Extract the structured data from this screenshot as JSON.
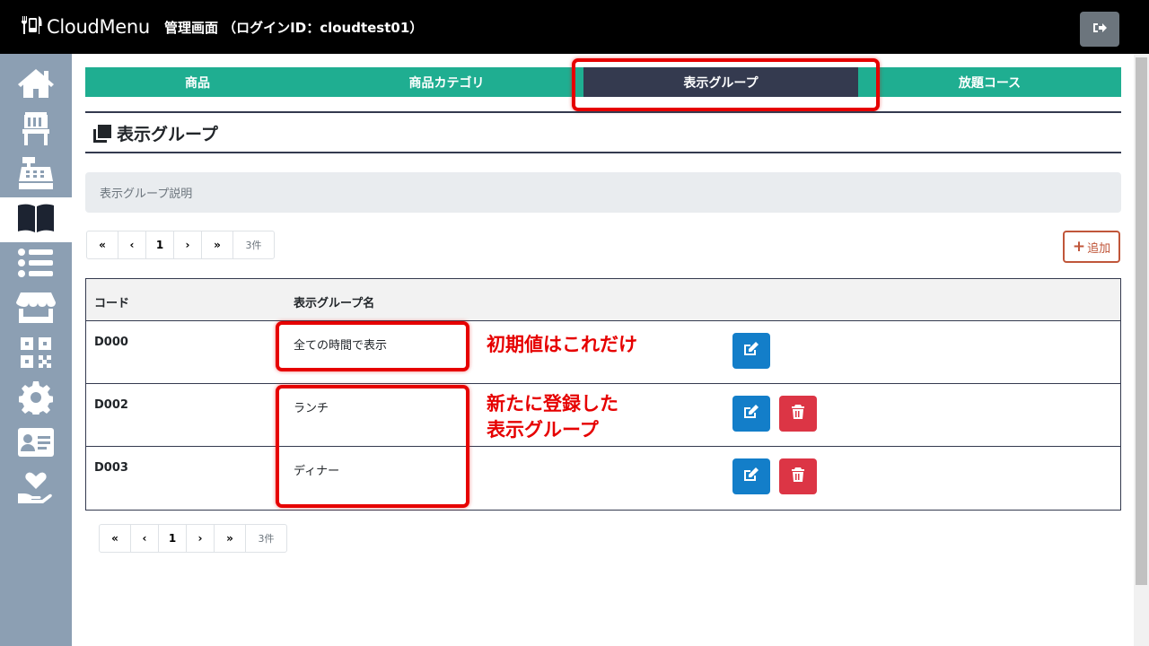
{
  "header": {
    "brand": "CloudMenu",
    "subtitle": "管理画面 （ログインID：cloudtest01）",
    "logout_icon": "sign-out-icon"
  },
  "sidebar": {
    "items": [
      {
        "icon": "home-icon"
      },
      {
        "icon": "chair-icon"
      },
      {
        "icon": "cash-register-icon"
      },
      {
        "icon": "book-icon",
        "active": true
      },
      {
        "icon": "list-icon"
      },
      {
        "icon": "store-icon"
      },
      {
        "icon": "qrcode-icon"
      },
      {
        "icon": "gear-icon"
      },
      {
        "icon": "id-card-icon"
      },
      {
        "icon": "hand-heart-icon"
      }
    ]
  },
  "tabs": [
    {
      "label": "商品"
    },
    {
      "label": "商品カテゴリ"
    },
    {
      "label": "表示グループ",
      "active": true
    },
    {
      "label": "放題コース"
    }
  ],
  "section": {
    "title": "表示グループ",
    "description": "表示グループ説明"
  },
  "pagination": {
    "first": "«",
    "prev": "‹",
    "page": "1",
    "next": "›",
    "last": "»",
    "count": "3件"
  },
  "add_button": {
    "label": "追加"
  },
  "table": {
    "headers": [
      "コード",
      "表示グループ名"
    ],
    "rows": [
      {
        "code": "D000",
        "name": "全ての時間で表示",
        "deletable": false
      },
      {
        "code": "D002",
        "name": "ランチ",
        "deletable": true
      },
      {
        "code": "D003",
        "name": "ディナー",
        "deletable": true
      }
    ]
  },
  "annotations": {
    "initial": "初期値はこれだけ",
    "new_line1": "新たに登録した",
    "new_line2": "表示グループ"
  },
  "colors": {
    "tab_bg": "#1fae91",
    "tab_active": "#343a4f",
    "sidebar_bg": "#8c9fb3",
    "edit_btn": "#137ec9",
    "delete_btn": "#dc3545",
    "highlight": "#e60000"
  }
}
